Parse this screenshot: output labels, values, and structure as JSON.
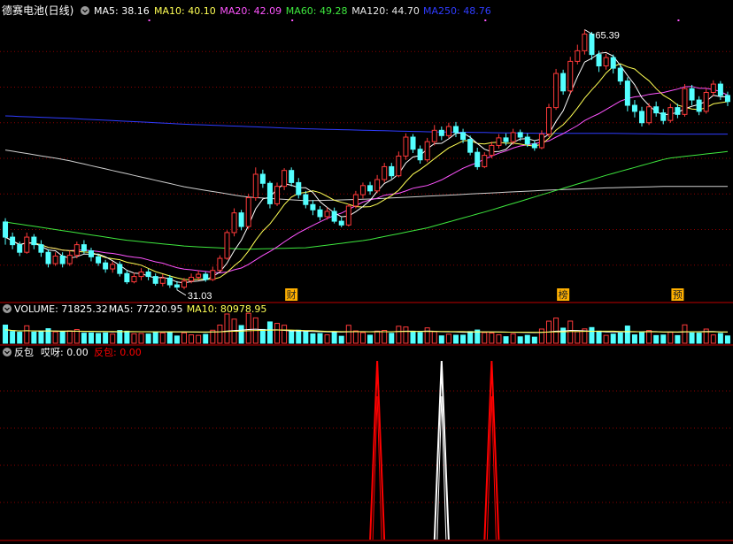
{
  "colors": {
    "bg": "#000000",
    "up": "#ff3a3a",
    "down": "#54ffff",
    "grid": "#8a0000",
    "sep": "#c00000",
    "ma5": "#ffffff",
    "ma10": "#ffff54",
    "ma20": "#ff54ff",
    "ma60": "#3ee83e",
    "ma120": "#cfcfcf",
    "ma250": "#2f3cff",
    "label": "#ffffff",
    "tag_bg": "#ffb000",
    "tag_text": "#202020",
    "marker": "#ff54ff",
    "spike_white": "#ffffff",
    "spike_red": "#ff0000"
  },
  "icon": "chevron-down-icon",
  "price_panel": {
    "title": "德赛电池(日线)",
    "indicators": [
      {
        "label": "MA5: 38.16",
        "color": "#ffffff"
      },
      {
        "label": "MA10: 40.10",
        "color": "#ffff54"
      },
      {
        "label": "MA20: 42.09",
        "color": "#ff54ff"
      },
      {
        "label": "MA60: 49.28",
        "color": "#3ee83e"
      },
      {
        "label": "MA120: 44.70",
        "color": "#e8e8e8"
      },
      {
        "label": "MA250: 48.76",
        "color": "#2f3cff"
      }
    ],
    "high_label": "65.39",
    "low_label": "31.03",
    "event_tags": [
      "财",
      "榜",
      "预"
    ]
  },
  "volume_panel": {
    "label": "VOLUME: 71825.32",
    "ma5": "MA5: 77220.95",
    "ma10": "MA10: 80978.95"
  },
  "signal_panel": {
    "name": "反包",
    "v1": "哎呀: 0.00",
    "v2": "反包: 0.00"
  },
  "chart_data": {
    "type": "candlestick",
    "title": "德赛电池(日线)",
    "candles": [
      [
        40,
        38,
        40.5,
        37
      ],
      [
        38,
        37,
        38.6,
        36.4
      ],
      [
        37,
        36,
        37.4,
        35.5
      ],
      [
        36,
        38,
        38.6,
        35.8
      ],
      [
        38,
        37,
        38.4,
        36.4
      ],
      [
        37,
        36,
        37.6,
        35.4
      ],
      [
        36,
        34.5,
        36.4,
        34
      ],
      [
        34.5,
        35.5,
        36,
        34.2
      ],
      [
        35.5,
        34.5,
        36,
        34
      ],
      [
        34.5,
        35.6,
        36.2,
        34.2
      ],
      [
        35.6,
        37,
        37.4,
        35.2
      ],
      [
        37,
        36.2,
        37.6,
        35.8
      ],
      [
        36.2,
        35.4,
        36.6,
        34.8
      ],
      [
        35.4,
        34.6,
        35.8,
        34.2
      ],
      [
        34.6,
        33.8,
        35,
        33.3
      ],
      [
        33.8,
        34.4,
        34.8,
        33.3
      ],
      [
        34.4,
        33.2,
        34.8,
        32.8
      ],
      [
        33.2,
        32.1,
        33.6,
        31.8
      ],
      [
        32.1,
        32.8,
        33.3,
        31.9
      ],
      [
        32.8,
        33.4,
        33.9,
        32.3
      ],
      [
        33.4,
        32.8,
        33.8,
        32.3
      ],
      [
        32.8,
        31.9,
        33.2,
        31.6
      ],
      [
        31.9,
        32.6,
        33.1,
        31.5
      ],
      [
        32.6,
        31.7,
        33,
        31.3
      ],
      [
        31.7,
        31.4,
        32.2,
        31.03
      ],
      [
        31.4,
        32.2,
        32.6,
        31.1
      ],
      [
        32.2,
        32.7,
        33.2,
        31.9
      ],
      [
        32.7,
        33.1,
        33.6,
        32.3
      ],
      [
        33.1,
        32.4,
        33.4,
        32.1
      ],
      [
        32.4,
        33.6,
        34.1,
        32.2
      ],
      [
        33.6,
        35.2,
        35.6,
        33.4
      ],
      [
        35.2,
        38.6,
        38.9,
        35
      ],
      [
        38.6,
        41.2,
        41.8,
        38.1
      ],
      [
        41.2,
        39.4,
        41.6,
        38.9
      ],
      [
        39.4,
        43.2,
        43.7,
        39.1
      ],
      [
        43.2,
        46.3,
        47.2,
        42.8
      ],
      [
        46.3,
        45.1,
        46.9,
        44.5
      ],
      [
        45.1,
        42.4,
        45.4,
        41.8
      ],
      [
        42.4,
        44.7,
        45.2,
        42.1
      ],
      [
        44.7,
        46.8,
        47.1,
        44.2
      ],
      [
        46.8,
        45.2,
        47.2,
        44.7
      ],
      [
        45.2,
        43.6,
        45.8,
        43.1
      ],
      [
        43.6,
        42.3,
        44.1,
        41.8
      ],
      [
        42.3,
        41.6,
        42.9,
        40.9
      ],
      [
        41.6,
        40.7,
        42.1,
        40.2
      ],
      [
        40.7,
        41.4,
        41.9,
        40.3
      ],
      [
        41.4,
        40.1,
        41.9,
        39.8
      ],
      [
        40.1,
        39.6,
        40.6,
        39.3
      ],
      [
        39.6,
        42.1,
        42.4,
        39.4
      ],
      [
        42.1,
        43.6,
        44.1,
        41.8
      ],
      [
        43.6,
        44.8,
        45.2,
        43.1
      ],
      [
        44.8,
        44.1,
        45.3,
        43.6
      ],
      [
        44.1,
        45.6,
        46.2,
        43.8
      ],
      [
        45.6,
        47.3,
        47.8,
        45.2
      ],
      [
        47.3,
        46.1,
        47.8,
        45.7
      ],
      [
        46.1,
        48.7,
        49.3,
        45.9
      ],
      [
        48.7,
        51.2,
        51.7,
        48.2
      ],
      [
        51.2,
        49.6,
        51.6,
        49.1
      ],
      [
        49.6,
        48.2,
        50.1,
        47.7
      ],
      [
        48.2,
        50.6,
        51.1,
        47.9
      ],
      [
        50.6,
        52.1,
        52.8,
        50.1
      ],
      [
        52.1,
        51.4,
        52.6,
        50.8
      ],
      [
        51.4,
        52.6,
        53.1,
        51.1
      ],
      [
        52.6,
        51.8,
        53.2,
        51.2
      ],
      [
        51.8,
        50.9,
        52.3,
        50.4
      ],
      [
        50.9,
        49.2,
        51.4,
        48.8
      ],
      [
        49.2,
        47.3,
        49.8,
        46.9
      ],
      [
        47.3,
        48.8,
        49.2,
        47.1
      ],
      [
        48.8,
        50.1,
        50.6,
        48.4
      ],
      [
        50.1,
        51.1,
        51.6,
        49.7
      ],
      [
        51.1,
        50.6,
        51.7,
        50.1
      ],
      [
        50.6,
        51.8,
        52.3,
        50.2
      ],
      [
        51.8,
        51.2,
        52.2,
        50.7
      ],
      [
        51.2,
        50.3,
        51.7,
        49.9
      ],
      [
        50.3,
        49.8,
        50.8,
        49.4
      ],
      [
        49.8,
        51.6,
        52.1,
        49.6
      ],
      [
        51.6,
        55.1,
        55.6,
        51.2
      ],
      [
        55.1,
        59.6,
        60.2,
        54.8
      ],
      [
        59.6,
        57.3,
        60.1,
        56.8
      ],
      [
        57.3,
        61.2,
        61.8,
        56.9
      ],
      [
        61.2,
        62.6,
        63.4,
        60.8
      ],
      [
        62.6,
        64.8,
        65.39,
        62.1
      ],
      [
        64.8,
        62.1,
        65.1,
        61.4
      ],
      [
        62.1,
        60.6,
        62.6,
        59.8
      ],
      [
        60.6,
        61.7,
        62.2,
        60.1
      ],
      [
        61.7,
        60.3,
        62.1,
        59.6
      ],
      [
        60.3,
        58.6,
        60.8,
        58.1
      ],
      [
        58.6,
        55.4,
        59.1,
        54.6
      ],
      [
        55.4,
        54.6,
        56.1,
        53.8
      ],
      [
        54.6,
        53.1,
        55.2,
        52.6
      ],
      [
        53.1,
        55.2,
        55.7,
        52.8
      ],
      [
        55.2,
        54.4,
        55.9,
        53.9
      ],
      [
        54.4,
        53.4,
        54.9,
        52.9
      ],
      [
        53.4,
        55.1,
        55.6,
        53.1
      ],
      [
        55.1,
        54.2,
        55.6,
        53.7
      ],
      [
        54.2,
        57.6,
        58.2,
        53.9
      ],
      [
        57.6,
        56.1,
        58.1,
        55.4
      ],
      [
        56.1,
        54.6,
        56.6,
        54.1
      ],
      [
        54.6,
        57.1,
        57.6,
        54.3
      ],
      [
        57.1,
        58.2,
        58.7,
        56.6
      ],
      [
        58.2,
        56.7,
        58.6,
        56.1
      ],
      [
        56.7,
        55.9,
        57.2,
        55.3
      ]
    ],
    "ma5_last": 38.16,
    "ma10_last": 40.1,
    "ma20_last": 42.09,
    "ma60_last": 49.28,
    "ma120_last": 44.7,
    "ma250_last": 48.76,
    "volume_last": 71825.32,
    "vol_ma5_last": 77220.95,
    "vol_ma10_last": 80978.95,
    "signal_spikes": [
      {
        "bar": 52,
        "color": "red"
      },
      {
        "bar": 61,
        "color": "white"
      },
      {
        "bar": 68,
        "color": "red"
      }
    ]
  }
}
